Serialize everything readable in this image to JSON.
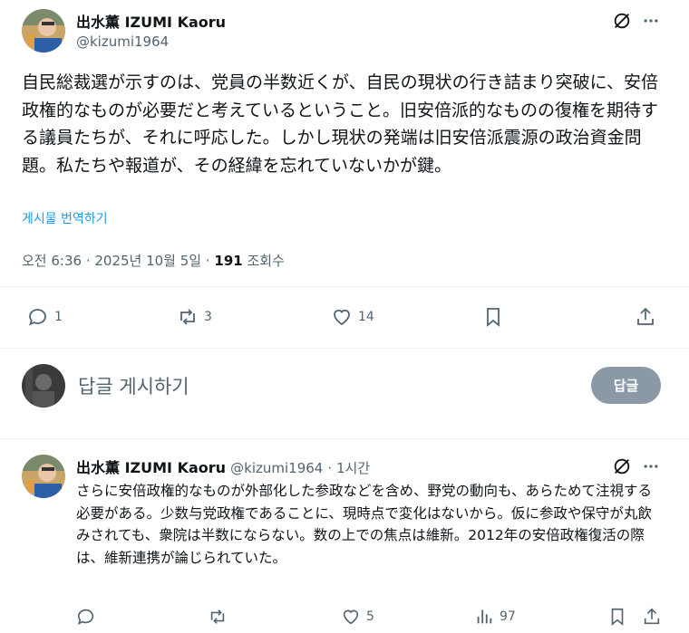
{
  "main_post": {
    "author_name": "出水薫 IZUMI Kaoru",
    "author_handle": "@kizumi1964",
    "text": "自民総裁選が示すのは、党員の半数近くが、自民の現状の行き詰まり突破に、安倍政権的なものが必要だと考えているということ。旧安倍派的なものの復権を期待する議員たちが、それに呼応した。しかし現状の発端は旧安倍派震源の政治資金問題。私たちや報道が、その経緯を忘れていないかが鍵。",
    "translate_label": "게시물 번역하기",
    "time_date": "오전 6:36 · 2025년 10월 5일 · ",
    "views_count": "191",
    "views_label": " 조회수",
    "stats": {
      "replies": "1",
      "reposts": "3",
      "likes": "14"
    }
  },
  "reply_composer": {
    "placeholder": "답글 게시하기",
    "button_label": "답글"
  },
  "reply_post": {
    "author_name": "出水薫 IZUMI Kaoru",
    "author_handle": "@kizumi1964",
    "time": "· 1시간",
    "text": "さらに安倍政権的なものが外部化した参政などを含め、野党の動向も、あらためて注視する必要がある。少数与党政権であることに、現時点で変化はないから。仮に参政や保守が丸飲みされても、衆院は半数にならない。数の上での焦点は維新。2012年の安倍政権復活の際は、維新連携が論じられていた。",
    "stats": {
      "replies": "",
      "reposts": "",
      "likes": "5",
      "views": "97"
    }
  },
  "colors": {
    "text": "#0f1419",
    "muted": "#536471",
    "link": "#1d9bf0",
    "button_disabled": "#8b98a5",
    "divider": "#eff3f4"
  },
  "icons": [
    "grok-icon",
    "more-icon",
    "reply-icon",
    "repost-icon",
    "like-icon",
    "bookmark-icon",
    "share-icon",
    "views-icon"
  ]
}
